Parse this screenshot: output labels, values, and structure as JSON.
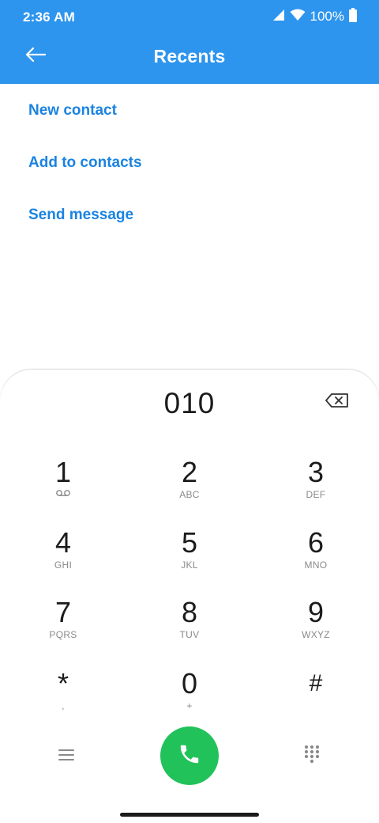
{
  "status_bar": {
    "time": "2:36 AM",
    "battery": "100%"
  },
  "header": {
    "title": "Recents",
    "back_icon": "back-arrow-icon"
  },
  "actions": [
    {
      "label": "New contact"
    },
    {
      "label": "Add to contacts"
    },
    {
      "label": "Send message"
    }
  ],
  "dialer": {
    "number": "010",
    "keys": [
      {
        "digit": "1",
        "letters": ""
      },
      {
        "digit": "2",
        "letters": "ABC"
      },
      {
        "digit": "3",
        "letters": "DEF"
      },
      {
        "digit": "4",
        "letters": "GHI"
      },
      {
        "digit": "5",
        "letters": "JKL"
      },
      {
        "digit": "6",
        "letters": "MNO"
      },
      {
        "digit": "7",
        "letters": "PQRS"
      },
      {
        "digit": "8",
        "letters": "TUV"
      },
      {
        "digit": "9",
        "letters": "WXYZ"
      },
      {
        "digit": "*",
        "letters": ","
      },
      {
        "digit": "0",
        "letters": "+"
      },
      {
        "digit": "#",
        "letters": ""
      }
    ]
  },
  "colors": {
    "header": "#2d95ee",
    "accent_link": "#1b83e0",
    "call": "#21c25a"
  }
}
